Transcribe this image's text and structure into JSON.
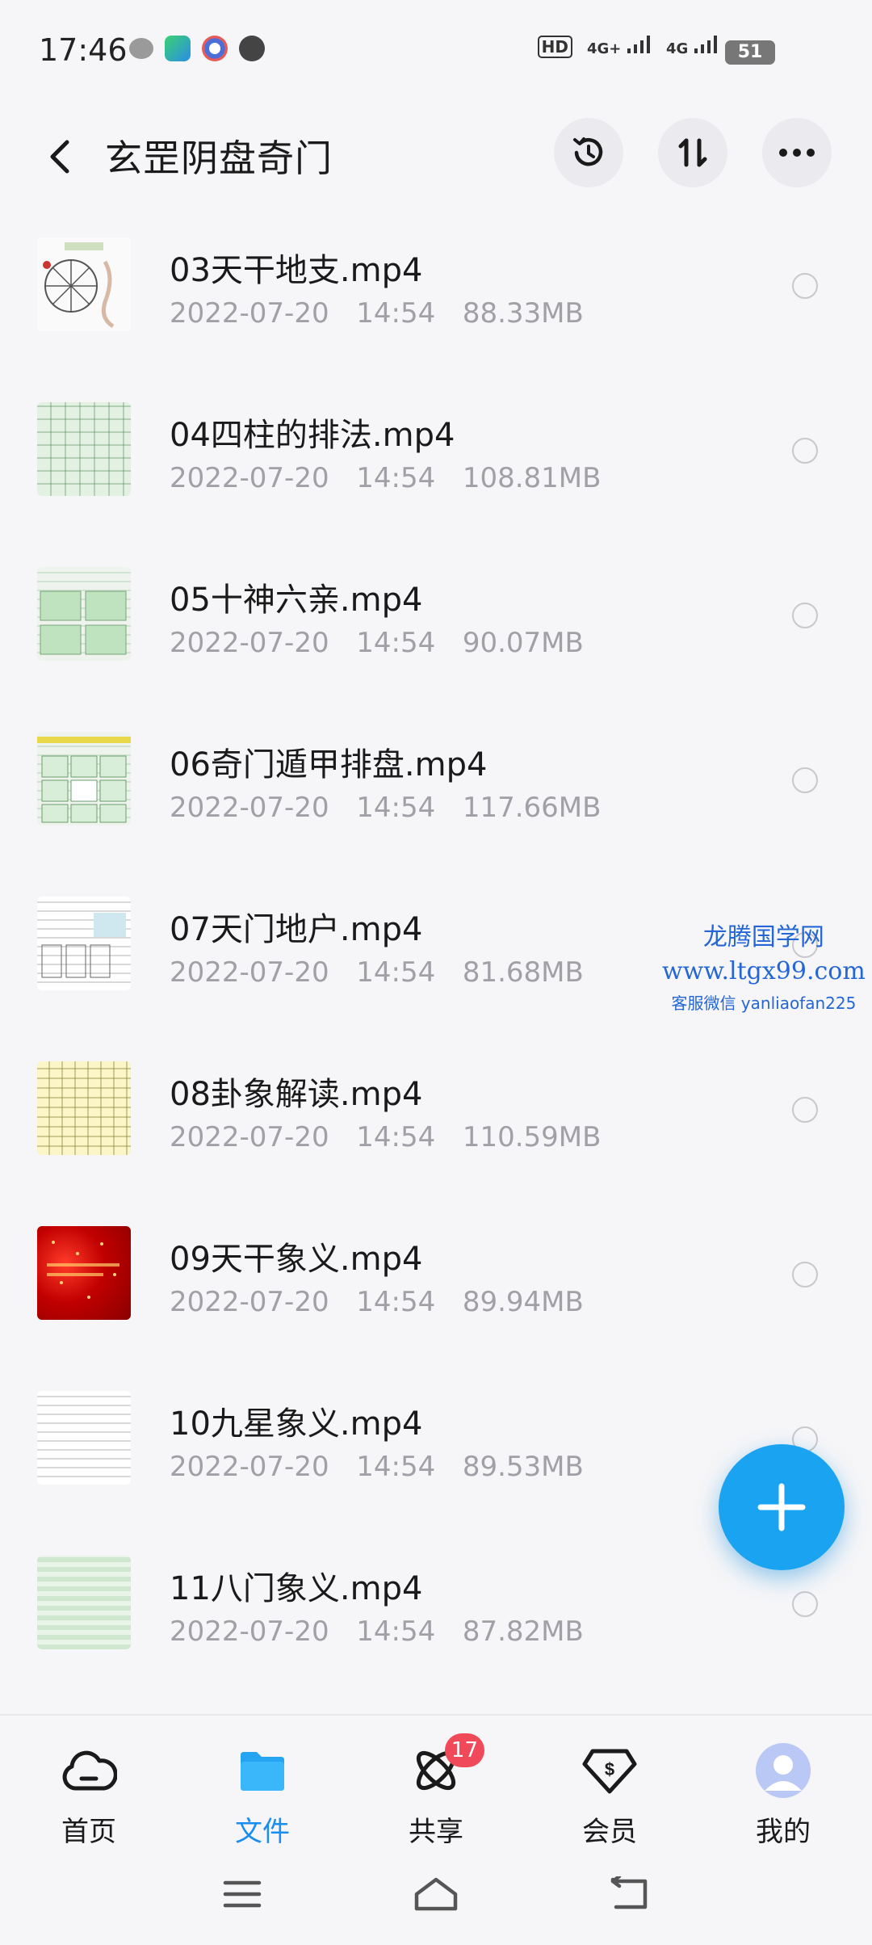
{
  "status_bar": {
    "time": "17:46",
    "battery": "51",
    "net1": "4G+",
    "net2": "4G",
    "hd": "HD"
  },
  "header": {
    "title": "玄罡阴盘奇门"
  },
  "files": [
    {
      "name": "03天干地支.mp4",
      "date": "2022-07-20",
      "time": "14:54",
      "size": "88.33MB"
    },
    {
      "name": "04四柱的排法.mp4",
      "date": "2022-07-20",
      "time": "14:54",
      "size": "108.81MB"
    },
    {
      "name": "05十神六亲.mp4",
      "date": "2022-07-20",
      "time": "14:54",
      "size": "90.07MB"
    },
    {
      "name": "06奇门遁甲排盘.mp4",
      "date": "2022-07-20",
      "time": "14:54",
      "size": "117.66MB"
    },
    {
      "name": "07天门地户.mp4",
      "date": "2022-07-20",
      "time": "14:54",
      "size": "81.68MB"
    },
    {
      "name": "08卦象解读.mp4",
      "date": "2022-07-20",
      "time": "14:54",
      "size": "110.59MB"
    },
    {
      "name": "09天干象义.mp4",
      "date": "2022-07-20",
      "time": "14:54",
      "size": "89.94MB"
    },
    {
      "name": "10九星象义.mp4",
      "date": "2022-07-20",
      "time": "14:54",
      "size": "89.53MB"
    },
    {
      "name": "11八门象义.mp4",
      "date": "2022-07-20",
      "time": "14:54",
      "size": "87.82MB"
    }
  ],
  "watermark": {
    "line1": "龙腾国学网",
    "line2": "www.ltgx99.com",
    "line3": "客服微信 yanliaofan225"
  },
  "nav": {
    "home": "首页",
    "files": "文件",
    "share": "共享",
    "share_badge": "17",
    "vip": "会员",
    "mine": "我的"
  },
  "colors": {
    "accent": "#1a8ef0",
    "fab": "#1aa3f0",
    "badge": "#f04a5a"
  }
}
